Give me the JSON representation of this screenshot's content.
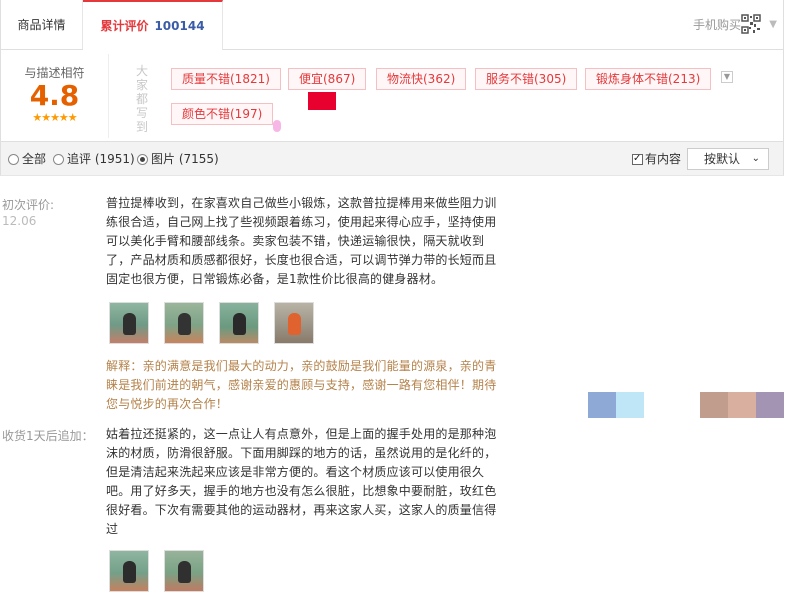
{
  "tabs": {
    "detail": "商品详情",
    "reviews": "累计评价",
    "reviews_count": "100144",
    "mobile_buy": "手机购买"
  },
  "rating": {
    "title": "与描述相符",
    "score": "4.8",
    "stars": "★★★★★",
    "score_value": 4.8
  },
  "tags_label": "大家都写到",
  "tags": [
    {
      "label": "质量不错(1821)"
    },
    {
      "label": "便宜(867)"
    },
    {
      "label": "物流快(362)"
    },
    {
      "label": "服务不错(305)"
    },
    {
      "label": "锻炼身体不错(213)"
    },
    {
      "label": "颜色不错(197)"
    }
  ],
  "filters": {
    "all": "全部",
    "followup": "追评 (1951)",
    "images": "图片 (7155)",
    "with_content": "有内容",
    "sort": "按默认",
    "selected": "images"
  },
  "review": {
    "first_label": "初次评价:",
    "first_date": "12.06",
    "first_lines": [
      "普拉提棒收到，在家喜欢自己做些小锻炼，这款普拉提棒用来做些阻力训",
      "练很合适，自己网上找了些视频跟着练习，使用起来得心应手，坚持使用",
      "可以美化手臂和腰部线条。卖家包装不错，快递运输很快，隔天就收到",
      "了，产品材质和质感都很好，长度也很合适，可以调节弹力带的长短而且",
      "固定也很方便，日常锻炼必备，是1款性价比很高的健身器材。"
    ],
    "reply_lines": [
      "解释：亲的满意是我们最大的动力，亲的鼓励是我们能量的源泉，亲的青",
      "睐是我们前进的朝气，感谢亲爱的惠顾与支持，感谢一路有您相伴！期待",
      "您与悦步的再次合作！"
    ],
    "followup_label": "收货1天后追加：",
    "followup_lines": [
      "姑着拉还挺紧的，这一点让人有点意外，但是上面的握手处用的是那种泡",
      "沫的材质，防滑很舒服。下面用脚踩的地方的话，虽然说用的是化纤的，",
      "但是清洁起来洗起来应该是非常方便的。看这个材质应该可以使用很久",
      "吧。用了好多天，握手的地方也没有怎么很脏，比想象中要耐脏，玫红色",
      "很好看。下次有需要其他的运动器材，再来这家人买，这家人的质量信得",
      "过"
    ]
  },
  "colors": {
    "accent": "#e4393c",
    "count_blue": "#3a5ca8",
    "score_orange": "#e56100",
    "reply_brown": "#b4824a"
  },
  "icons": [
    "qr-code-icon",
    "chevron-down-icon",
    "radio-icon",
    "checkbox-icon",
    "star-icon"
  ]
}
